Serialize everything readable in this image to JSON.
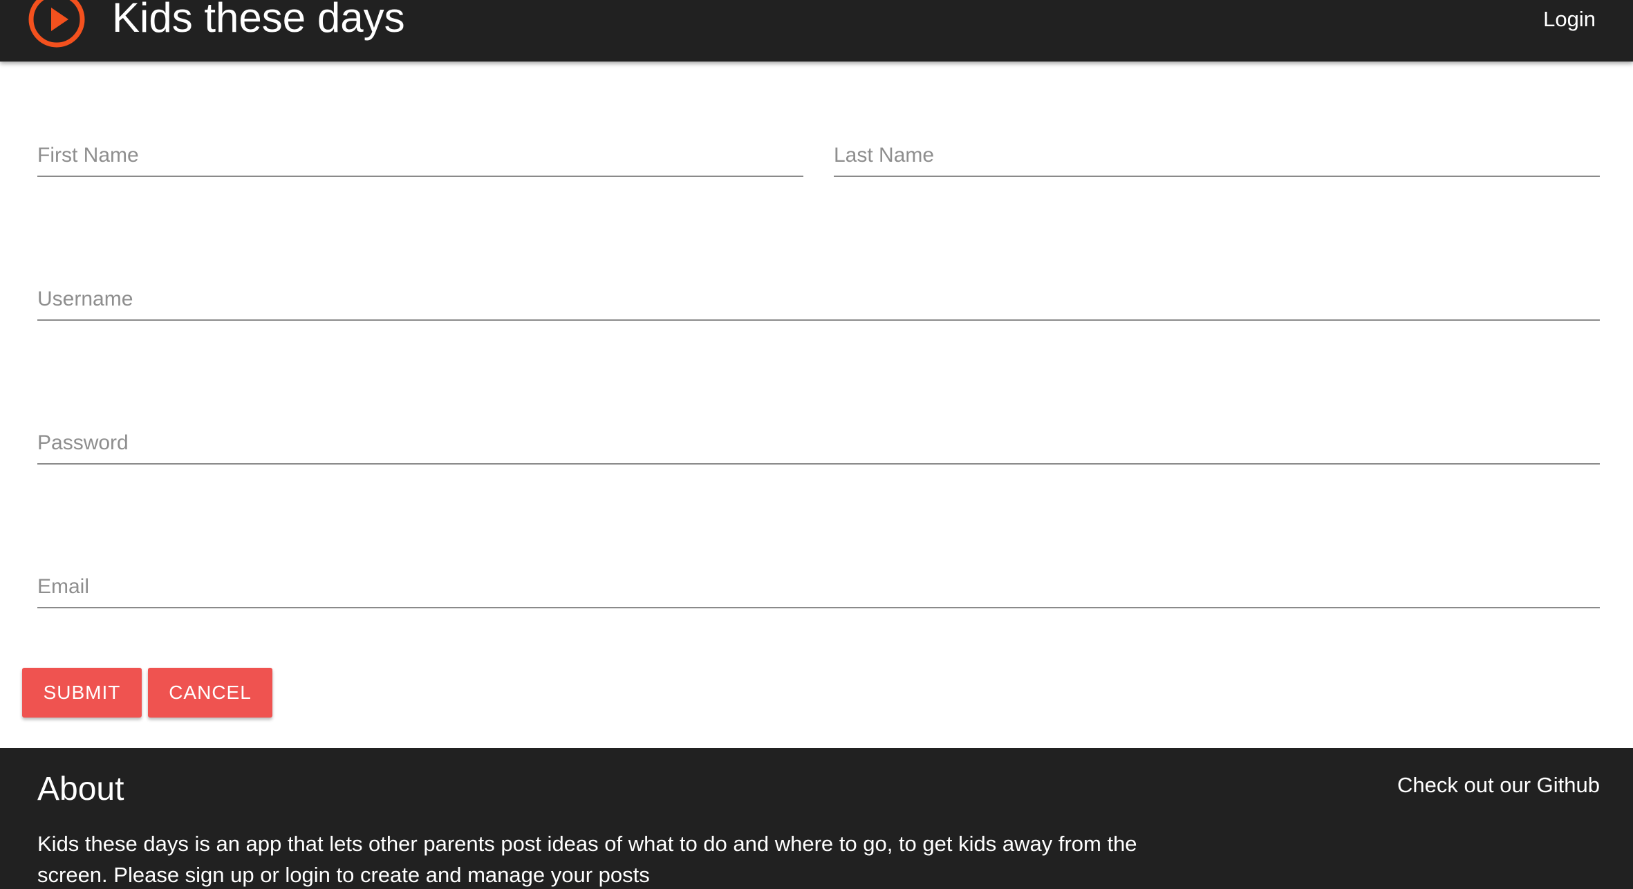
{
  "header": {
    "brand": "Kids these days",
    "login_label": "Login",
    "logo_icon": "play-circle-icon",
    "background_color": "#212121",
    "logo_color": "#f4511e"
  },
  "form": {
    "first_name_placeholder": "First Name",
    "last_name_placeholder": "Last Name",
    "username_placeholder": "Username",
    "password_placeholder": "Password",
    "email_placeholder": "Email",
    "submit_label": "SUBMIT",
    "cancel_label": "CANCEL",
    "button_color": "#ef5350"
  },
  "footer": {
    "about_title": "About",
    "about_text": "Kids these days is an app that lets other parents post ideas of what to do and where to go, to get kids away from the screen. Please sign up or login to create and manage your posts",
    "github_label": "Check out our Github",
    "background_color": "#212121"
  }
}
